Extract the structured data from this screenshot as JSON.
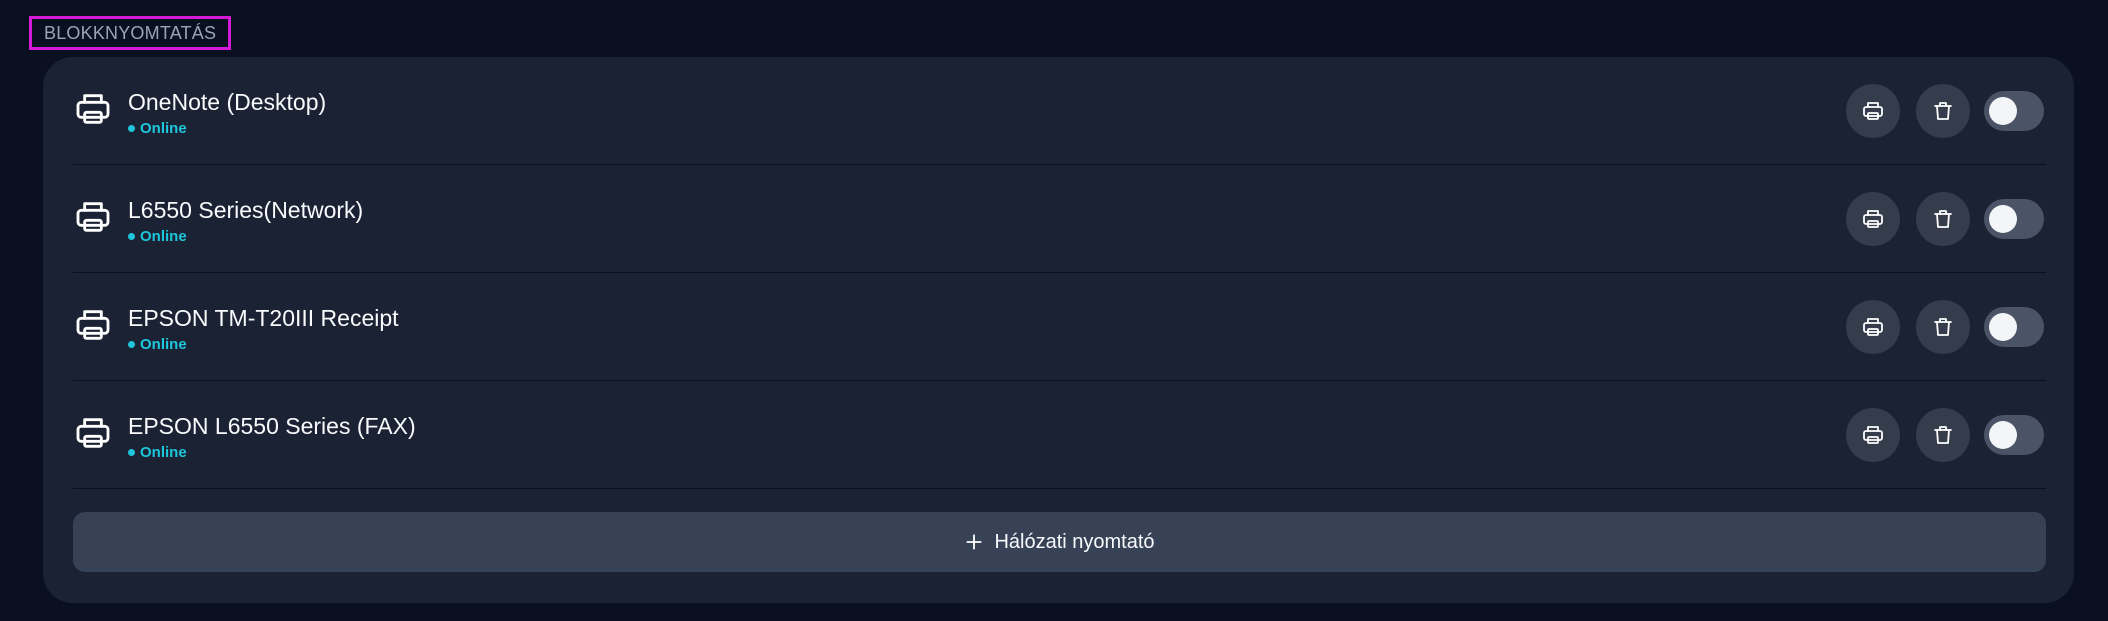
{
  "section": {
    "title": "BLOKKNYOMTATÁS"
  },
  "printers": [
    {
      "name": "OneNote (Desktop)",
      "status": "Online",
      "icon": "printer-icon",
      "actions": {
        "print_icon": "printer-icon",
        "delete_icon": "trash-icon"
      },
      "toggle_on": false
    },
    {
      "name": "L6550 Series(Network)",
      "status": "Online",
      "icon": "printer-icon",
      "actions": {
        "print_icon": "printer-icon",
        "delete_icon": "trash-icon"
      },
      "toggle_on": false
    },
    {
      "name": "EPSON TM-T20III Receipt",
      "status": "Online",
      "icon": "printer-icon",
      "actions": {
        "print_icon": "printer-icon",
        "delete_icon": "trash-icon"
      },
      "toggle_on": false
    },
    {
      "name": "EPSON L6550 Series (FAX)",
      "status": "Online",
      "icon": "printer-icon",
      "actions": {
        "print_icon": "printer-icon",
        "delete_icon": "trash-icon"
      },
      "toggle_on": false
    }
  ],
  "add_printer": {
    "label": "Hálózati nyomtató",
    "icon": "plus-icon"
  },
  "colors": {
    "background": "#0b1020",
    "panel": "#1b2233",
    "status_online": "#1ec6dc",
    "highlight_border": "#d61bd8",
    "button_bg": "#353d4d",
    "toggle_off": "#4b5367"
  }
}
